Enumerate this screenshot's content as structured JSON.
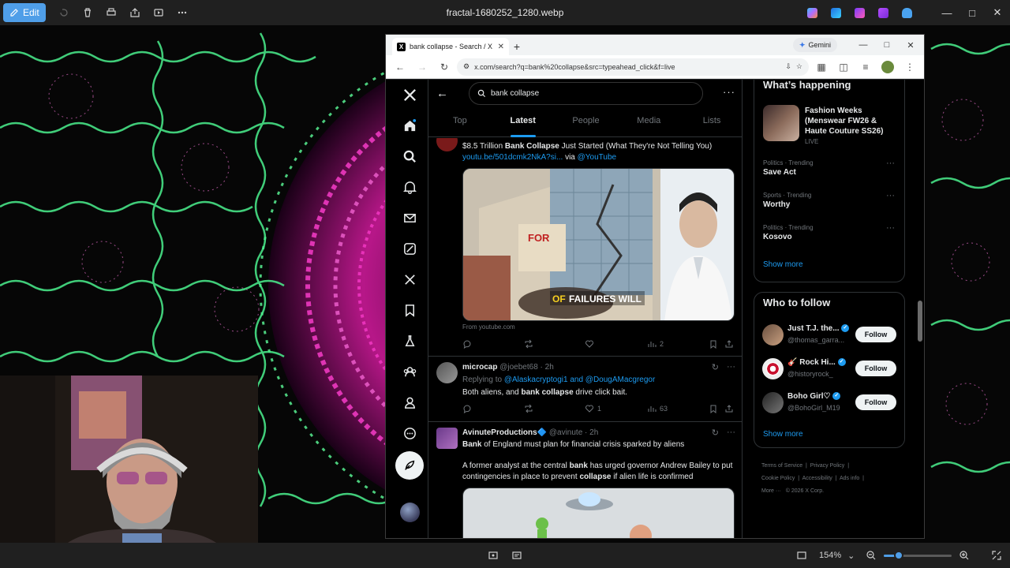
{
  "viewer": {
    "edit_label": "Edit",
    "file_title": "fractal-1680252_1280.webp",
    "zoom_level": "154%",
    "zoom_fraction": 0.22
  },
  "browser": {
    "tab_title": "bank collapse - Search / X",
    "gemini_label": "Gemini",
    "url": "x.com/search?q=bank%20collapse&src=typeahead_click&f=live"
  },
  "search": {
    "query": "bank collapse",
    "tabs": [
      "Top",
      "Latest",
      "People",
      "Media",
      "Lists"
    ],
    "active_tab": "Latest"
  },
  "tweet1": {
    "text_pre": "$8.5 Trillion ",
    "text_bold": "Bank Collapse",
    "text_post": " Just Started (What They're Not Telling You)",
    "link": "youtu.be/501dcmk2NkA?si...",
    "via_word": " via ",
    "via_handle": "@YouTube",
    "media_caption_accent": "OF",
    "media_caption_rest": " FAILURES WILL",
    "from_label": "From youtube.com",
    "views": "2"
  },
  "tweet2": {
    "name": "microcap",
    "handle_time": "@joebet68 · 2h",
    "replying_label": "Replying to ",
    "replying_to": "@Alaskacryptogi1 and @DougAMacgregor",
    "text_pre": "Both aliens, and ",
    "text_bold": "bank collapse",
    "text_post": " drive click bait.",
    "likes": "1",
    "views": "63"
  },
  "tweet3": {
    "name": "AvinuteProductions🔷",
    "handle_time": "@avinute · 2h",
    "line1_bold": "Bank",
    "line1_rest": " of England must plan for financial crisis sparked by aliens",
    "line2_pre": "A former analyst at the central ",
    "line2_bold": "bank",
    "line2_mid": " has urged governor Andrew Bailey to put contingencies in place to prevent ",
    "line2_bold2": "collapse",
    "line2_post": " if alien life is confirmed"
  },
  "sidebar": {
    "whats_happening": "What’s happening",
    "event_title": "Fashion Weeks (Menswear FW26 & Haute Couture SS26)",
    "event_status": "LIVE",
    "trends": [
      {
        "meta": "Politics · Trending",
        "name": "Save Act"
      },
      {
        "meta": "Sports · Trending",
        "name": "Worthy"
      },
      {
        "meta": "Politics · Trending",
        "name": "Kosovo"
      }
    ],
    "show_more": "Show more",
    "who_to_follow": "Who to follow",
    "follow_label": "Follow",
    "accounts": [
      {
        "name": "Just T.J. the...",
        "handle": "@thomas_garra..."
      },
      {
        "name": "🎸 Rock Hi...",
        "handle": "@historyrock_"
      },
      {
        "name": "Boho Girl♡",
        "handle": "@BohoGirl_M19"
      }
    ],
    "show_more_2": "Show more",
    "footer": [
      "Terms of Service",
      "Privacy Policy",
      "Cookie Policy",
      "Accessibility",
      "Ads info",
      "More ···",
      "© 2026 X Corp."
    ]
  },
  "icons": {
    "nav": [
      "x-logo-icon",
      "home-icon",
      "search-icon",
      "notifications-icon",
      "messages-icon",
      "grok-icon",
      "premium-x-icon",
      "bookmarks-icon",
      "jobs-icon",
      "communities-icon",
      "profile-icon",
      "more-icon"
    ]
  },
  "colors": {
    "x_blue": "#1d9bf0",
    "viewer_accent": "#4f9ee8",
    "page_bg": "#000000"
  }
}
